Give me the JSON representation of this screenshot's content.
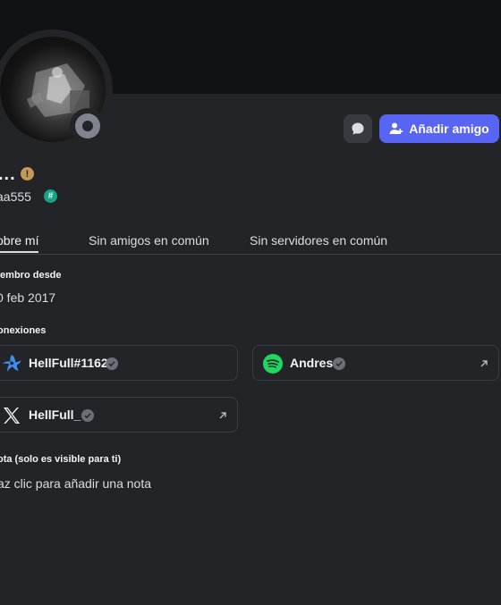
{
  "profile": {
    "display_name": "...",
    "username": "aa555",
    "status": "offline",
    "warning_icon": "exclamation-icon",
    "badge_icon": "hashtag-badge-icon"
  },
  "actions": {
    "message_icon": "chat-bubble-icon",
    "add_friend_label": "Añadir amigo",
    "add_friend_icon": "user-plus-icon",
    "accent_color": "#5865f2"
  },
  "tabs": [
    {
      "label": "obre mí",
      "active": true
    },
    {
      "label": "Sin amigos en común",
      "active": false
    },
    {
      "label": "Sin servidores en común",
      "active": false
    }
  ],
  "member_since": {
    "heading": "iembro desde",
    "value": "0 feb 2017"
  },
  "connections": {
    "heading": "onexiones",
    "items": [
      {
        "name": "HellFull#1162",
        "service": "battlenet-icon",
        "verified": true
      },
      {
        "name": "Andres",
        "service": "spotify-icon",
        "verified": true
      },
      {
        "name": "HellFull_",
        "service": "x-twitter-icon",
        "verified": true
      }
    ]
  },
  "note": {
    "heading": "ota (solo es visible para ti)",
    "placeholder": "az clic para añadir una nota"
  }
}
